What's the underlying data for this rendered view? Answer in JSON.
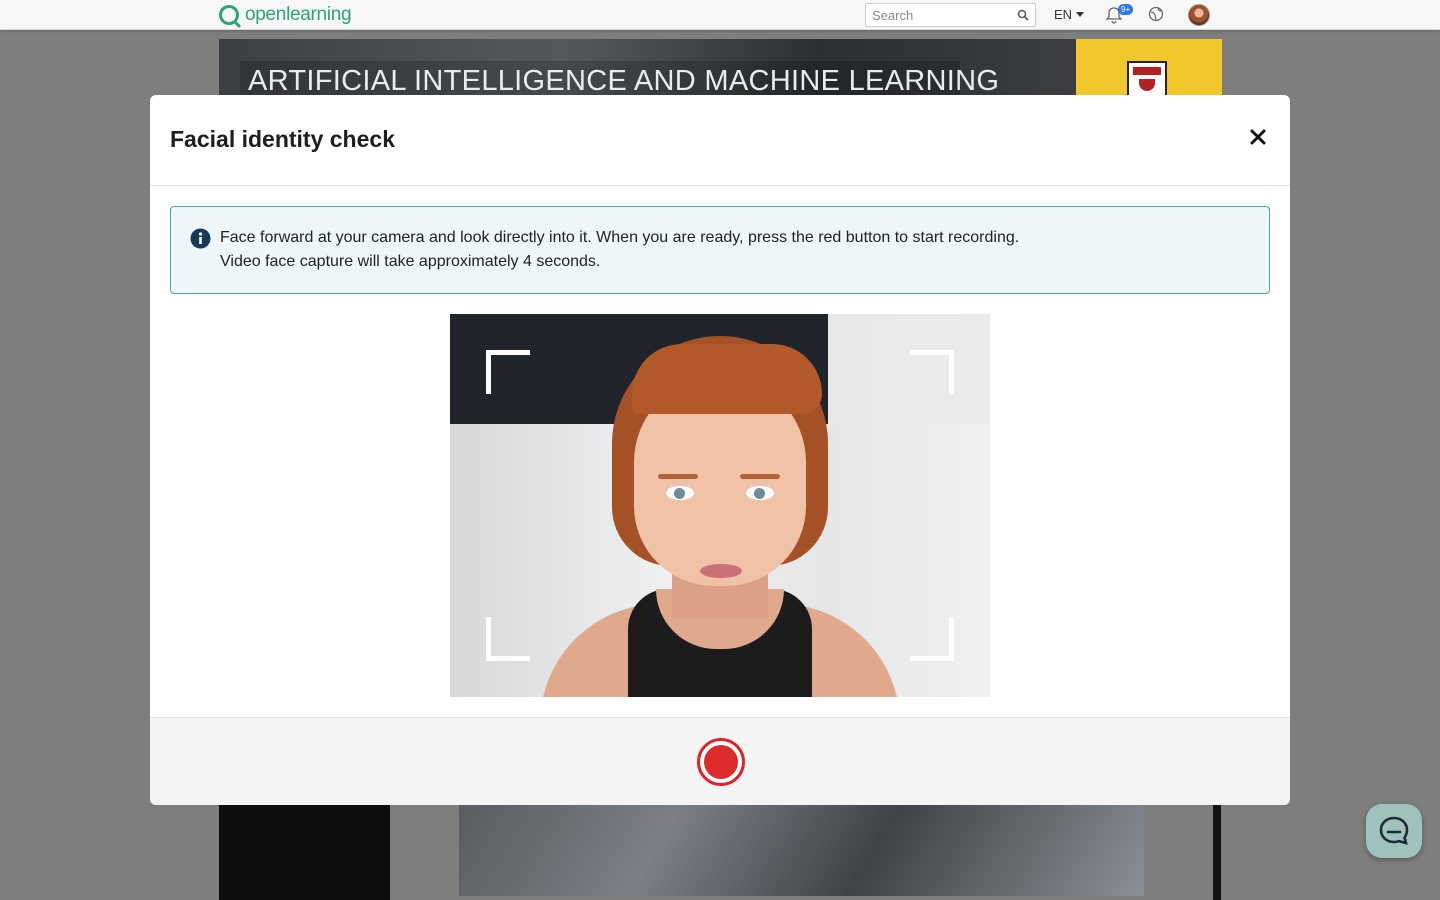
{
  "topbar": {
    "logo_text": "openlearning",
    "search_placeholder": "Search",
    "language": "EN",
    "notification_badge": "9+"
  },
  "course": {
    "title": "ARTIFICIAL INTELLIGENCE AND MACHINE LEARNING"
  },
  "modal": {
    "title": "Facial identity check",
    "close_label": "×",
    "info_line_1": "Face forward at your camera and look directly into it. When you are ready, press the red button to start recording.",
    "info_line_2": "Video face capture will take approximately 4 seconds.",
    "record_button_color": "#dd2a2a"
  },
  "colors": {
    "brand": "#2aa37d",
    "info_border": "#43a3c3",
    "info_bg": "#eef6f9",
    "crest_bg": "#f1c82c"
  }
}
